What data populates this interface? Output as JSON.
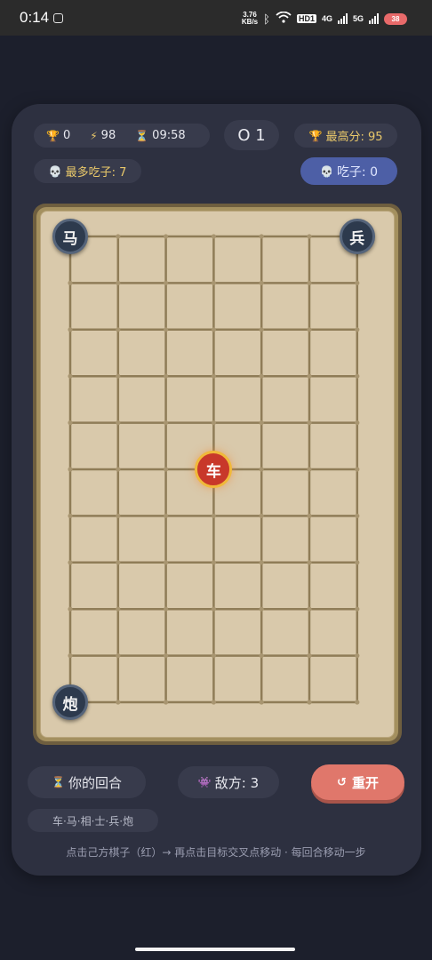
{
  "status_bar": {
    "time": "0:14",
    "net_speed_value": "3.76",
    "net_speed_unit": "KB/s",
    "hd_badge": "HD1",
    "net_4g": "4G",
    "net_5g": "5G",
    "battery": "38"
  },
  "stats": {
    "score": "0",
    "energy": "98",
    "timer": "09:58",
    "round": "O 1",
    "best_score": "最高分: 95",
    "most_captures": "最多吃子: 7",
    "captures": "吃子: 0"
  },
  "board": {
    "columns": 7,
    "rows": 10,
    "pieces": [
      {
        "char": "马",
        "side": "black",
        "col": 0,
        "row": 0
      },
      {
        "char": "兵",
        "side": "black",
        "col": 6,
        "row": 0
      },
      {
        "char": "车",
        "side": "red",
        "col": 3,
        "row": 5
      },
      {
        "char": "炮",
        "side": "black",
        "col": 0,
        "row": 10
      }
    ]
  },
  "controls": {
    "turn": "你的回合",
    "enemies": "敌方: 3",
    "restart": "重开",
    "piece_types": "车·马·相·士·兵·炮"
  },
  "tip": "点击己方棋子（红）→ 再点击目标交叉点移动 · 每回合移动一步",
  "icons": {
    "trophy": "trophy-icon",
    "lightning": "lightning-icon",
    "hourglass": "hourglass-icon",
    "skull": "skull-icon",
    "alien": "alien-icon",
    "restart": "restart-icon"
  },
  "colors": {
    "background": "#1c1f2c",
    "card": "#2d3040",
    "accent_red": "#c8382a",
    "restart_button": "#e0776b",
    "captures_pill": "#4d5fa6",
    "gold_text": "#e9c86a"
  }
}
